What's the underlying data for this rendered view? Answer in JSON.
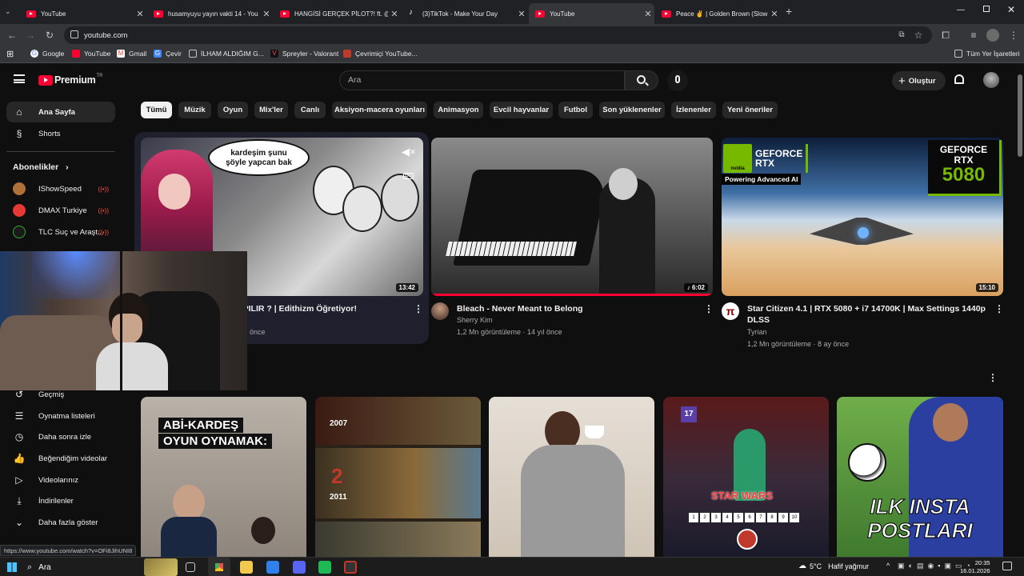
{
  "browser": {
    "tabs": [
      {
        "title": "YouTube",
        "kind": "youtube"
      },
      {
        "title": "husamyuyu yayın vakti 14 - You",
        "kind": "youtube"
      },
      {
        "title": "HANGİSİ GERÇEK PİLOT?! ft. @",
        "kind": "youtube"
      },
      {
        "title": "(3)TikTok - Make Your Day",
        "kind": "tiktok"
      },
      {
        "title": "YouTube",
        "kind": "youtube"
      },
      {
        "title": "Peace ✌ | Golden Brown (Slow",
        "kind": "youtube"
      }
    ],
    "active_tab": 4,
    "url": "youtube.com",
    "bookmarks": [
      "Google",
      "YouTube",
      "Gmail",
      "Çevir",
      "İLHAM ALDIĞIM G...",
      "Spreyler - Valorant",
      "Çevrimiçi YouTube..."
    ],
    "all_bookmarks": "Tüm Yer İşaretleri",
    "status_url": "https://www.youtube.com/watch?v=OFi8JihUNI8"
  },
  "youtube": {
    "logo": "Premium",
    "region": "TR",
    "search_placeholder": "Ara",
    "create_label": "Oluştur",
    "chips": [
      "Tümü",
      "Müzik",
      "Oyun",
      "Mix'ler",
      "Canlı",
      "Aksiyon-macera oyunları",
      "Animasyon",
      "Evcil hayvanlar",
      "Futbol",
      "Son yüklenenler",
      "İzlenenler",
      "Yeni öneriler"
    ],
    "sidebar": {
      "home": "Ana Sayfa",
      "shorts": "Shorts",
      "subs_heading": "Abonelikler",
      "channels": [
        "IShowSpeed",
        "DMAX Turkiye",
        "TLC Suç ve Araşt..."
      ],
      "you_items": [
        "Geçmiş",
        "Oynatma listeleri",
        "Daha sonra izle",
        "Beğendiğim videolar",
        "Videolarınız",
        "İndirilenler",
        "Daha fazla göster"
      ]
    },
    "videos_row1": [
      {
        "title": "YAPILIR ? | Edithizm Öğretiyor!",
        "meta2": "önce",
        "duration": "13:42",
        "thumb_text1": "kardeşim şunu",
        "thumb_text2": "şöyle yapcan bak",
        "cc": "CC"
      },
      {
        "title": "Bleach - Never Meant to Belong",
        "channel": "Sherry Kim",
        "meta": "1,2 Mn görüntüleme · 14 yıl önce",
        "duration": "6:02"
      },
      {
        "title_line1": "Star Citizen 4.1 | RTX 5080 + i7 14700K | Max Settings 1440p",
        "title_line2": "DLSS",
        "channel": "Tyrian",
        "meta": "1,2 Mn görüntüleme · 8 ay önce",
        "duration": "15:10",
        "nvidia_l1": "GEFORCE",
        "nvidia_l2": "RTX",
        "nvidia_sub": "Powering Advanced AI",
        "badge_l1": "GEFORCE",
        "badge_l2": "RTX",
        "badge_num": "5080"
      }
    ],
    "videos_row2": [
      {
        "thumb_text1": "ABİ-KARDEŞ",
        "thumb_text2": "OYUN OYNAMAK:"
      },
      {
        "year1": "2007",
        "num2": "2",
        "year2": "2011"
      },
      {},
      {
        "level": "17",
        "text": "STAR WARS",
        "keys": [
          "1",
          "2",
          "3",
          "4",
          "5",
          "6",
          "7",
          "8",
          "9",
          "10"
        ]
      },
      {
        "thumb_text1": "ILK INSTA",
        "thumb_text2": "POSTLARI"
      }
    ]
  },
  "taskbar": {
    "search": "Ara",
    "weather": "5°C",
    "weather_desc": "Hafif yağmur",
    "time": "20:35",
    "date": "16.01.2026"
  },
  "colors": {
    "youtube_red": "#ff0033",
    "nvidia_green": "#76b900"
  }
}
